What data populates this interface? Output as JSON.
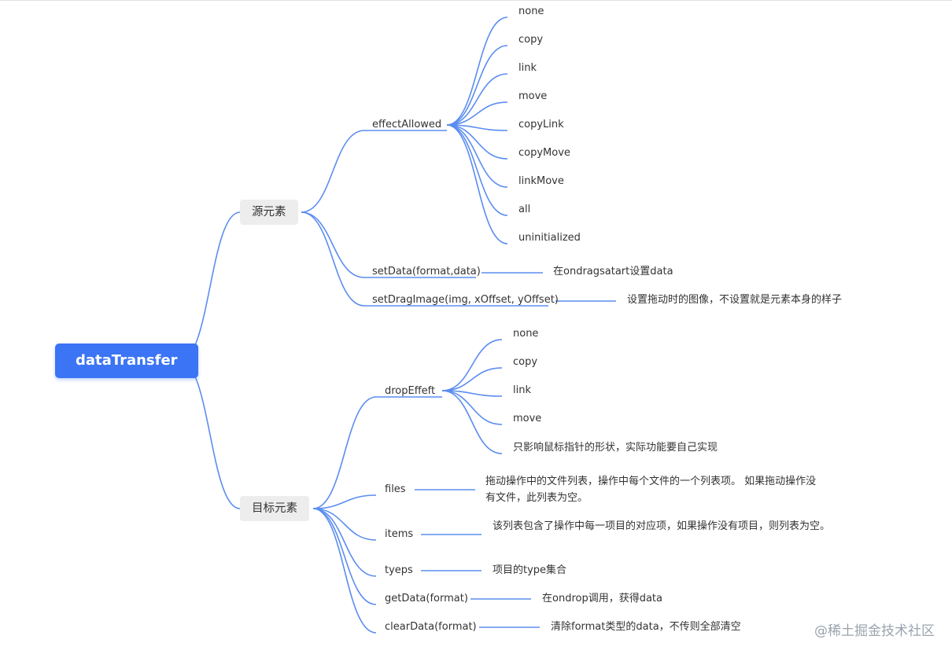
{
  "accent_color": "#3b74f4",
  "link_color": "#5b8def",
  "root": {
    "label": "dataTransfer"
  },
  "source": {
    "label": "源元素",
    "effect_allowed": {
      "label": "effectAllowed",
      "values": [
        "none",
        "copy",
        "link",
        "move",
        "copyLink",
        "copyMove",
        "linkMove",
        "all",
        "uninitialized"
      ]
    },
    "set_data": {
      "label": "setData(format,data)",
      "note": "在ondragsatart设置data"
    },
    "set_drag_image": {
      "label": "setDragImage(img, xOffset, yOffset)",
      "note": "设置拖动时的图像，不设置就是元素本身的样子"
    }
  },
  "target": {
    "label": "目标元素",
    "drop_effect": {
      "label": "dropEffeft",
      "values": [
        "none",
        "copy",
        "link",
        "move",
        "只影响鼠标指针的形状，实际功能要自己实现"
      ]
    },
    "files": {
      "label": "files",
      "note": "拖动操作中的文件列表，操作中每个文件的一个列表项。 如果拖动操作没有文件，此列表为空。"
    },
    "items": {
      "label": "items",
      "note": "该列表包含了操作中每一项目的对应项，如果操作没有项目，则列表为空。"
    },
    "types": {
      "label": "tyeps",
      "note": "项目的type集合"
    },
    "get_data": {
      "label": "getData(format)",
      "note": "在ondrop调用，获得data"
    },
    "clear_data": {
      "label": "clearData(format)",
      "note": "清除format类型的data，不传则全部清空"
    }
  },
  "watermark": "@稀土掘金技术社区"
}
